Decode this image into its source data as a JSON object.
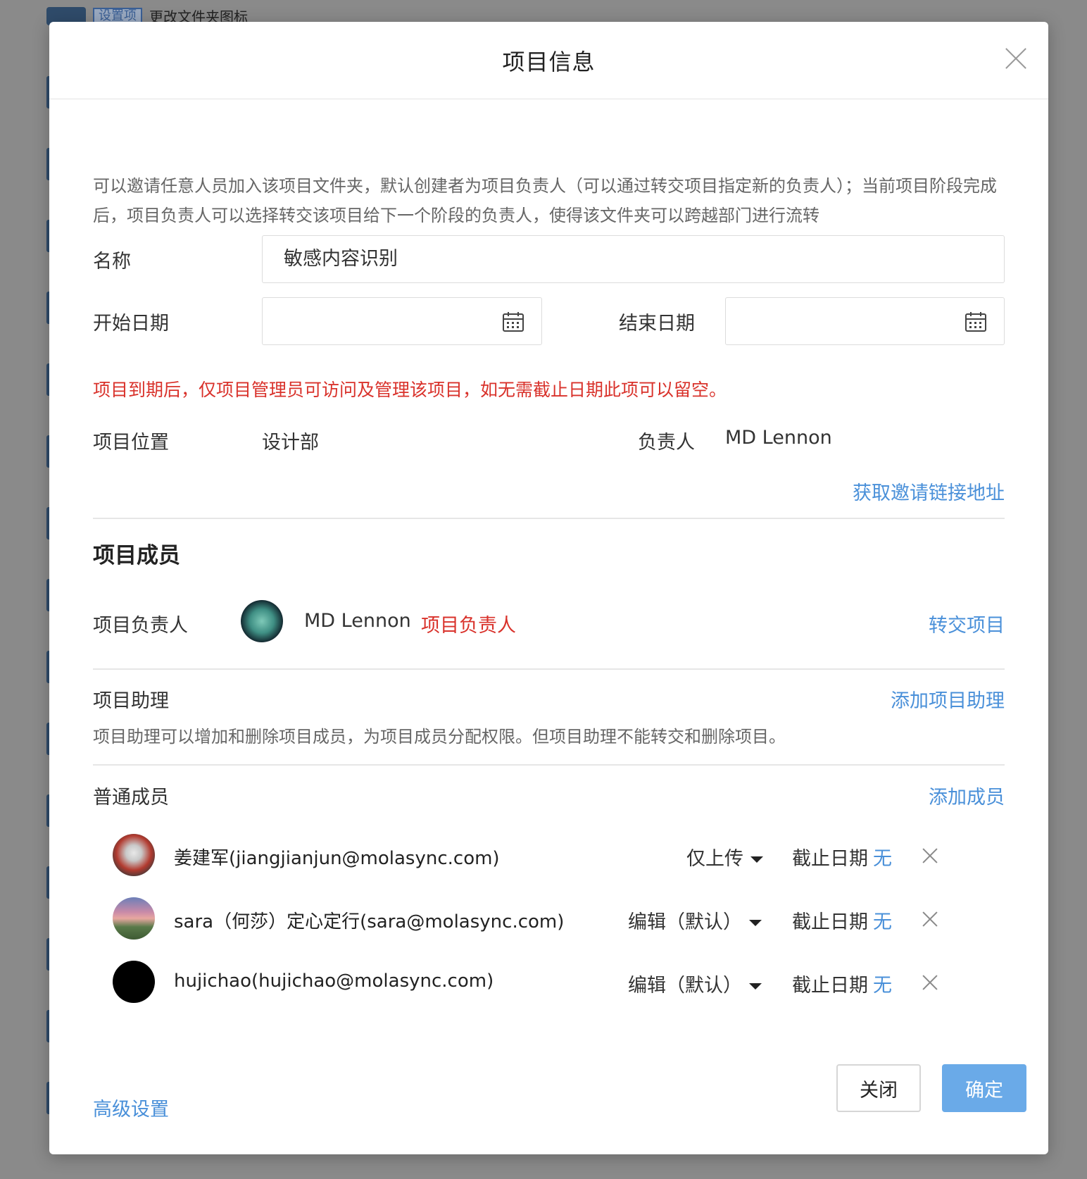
{
  "background": {
    "tag": "设置项",
    "text": "更改文件夹图标"
  },
  "modal": {
    "title": "项目信息",
    "intro": "可以邀请任意人员加入该项目文件夹，默认创建者为项目负责人（可以通过转交项目指定新的负责人）；当前项目阶段完成后，项目负责人可以选择转交该项目给下一个阶段的负责人，使得该文件夹可以跨越部门进行流转",
    "form": {
      "name_label": "名称",
      "name_value": "敏感内容识别",
      "start_label": "开始日期",
      "start_value": "",
      "end_label": "结束日期",
      "end_value": "",
      "warning": "项目到期后，仅项目管理员可访问及管理该项目，如无需截止日期此项可以留空。",
      "location_label": "项目位置",
      "location_value": "设计部",
      "owner_label": "负责人",
      "owner_value": "MD Lennon",
      "invite_link": "获取邀请链接地址"
    },
    "members": {
      "title": "项目成员",
      "owner_row_label": "项目负责人",
      "owner_name": "MD Lennon",
      "owner_role": "项目负责人",
      "transfer_link": "转交项目",
      "assistant_label": "项目助理",
      "add_assistant_link": "添加项目助理",
      "assistant_note": "项目助理可以增加和删除项目成员，为项目成员分配权限。但项目助理不能转交和删除项目。",
      "regular_label": "普通成员",
      "add_member_link": "添加成员",
      "list": [
        {
          "name": "姜建军(jiangjianjun@molasync.com)",
          "permission": "仅上传",
          "due_label": "截止日期",
          "due_value": "无"
        },
        {
          "name": "sara（何莎）定心定行(sara@molasync.com)",
          "permission": "编辑（默认）",
          "due_label": "截止日期",
          "due_value": "无"
        },
        {
          "name": "hujichao(hujichao@molasync.com)",
          "permission": "编辑（默认）",
          "due_label": "截止日期",
          "due_value": "无"
        }
      ]
    },
    "footer": {
      "advanced_link": "高级设置",
      "close_button": "关闭",
      "ok_button": "确定"
    }
  },
  "colors": {
    "accent": "#4a90d9",
    "warning": "#d9322b",
    "primary_button": "#6aaae8"
  }
}
